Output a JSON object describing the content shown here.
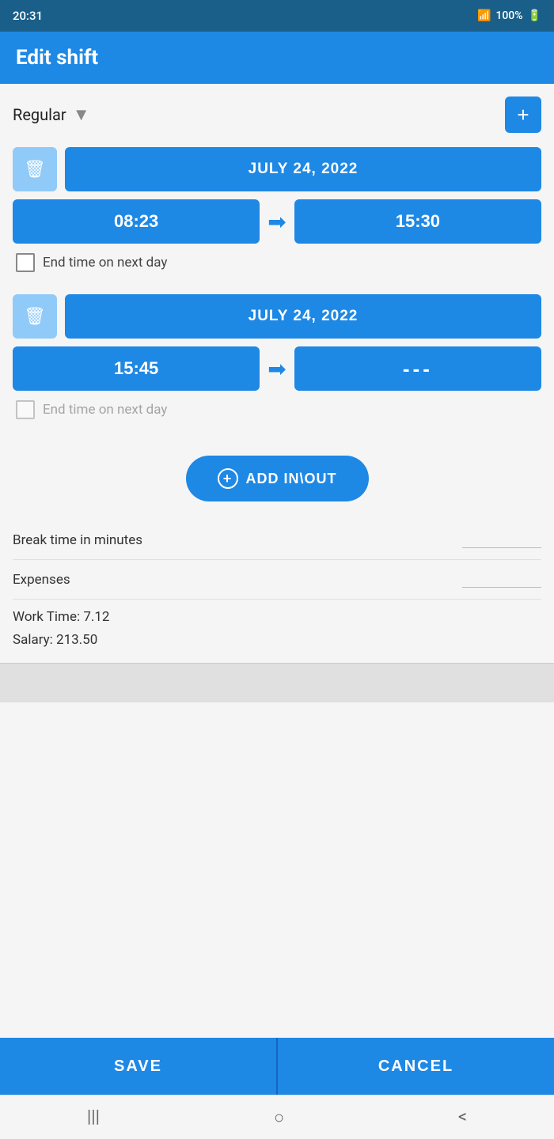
{
  "statusBar": {
    "time": "20:31",
    "battery": "100%",
    "signal": "WiFi+Cell"
  },
  "header": {
    "title": "Edit shift"
  },
  "shiftType": {
    "label": "Regular",
    "addButtonLabel": "+"
  },
  "shifts": [
    {
      "date": "JULY 24, 2022",
      "startTime": "08:23",
      "endTime": "15:30",
      "endNextDay": false,
      "endNextDayLabel": "End time on next day",
      "hasEndTime": true
    },
    {
      "date": "JULY 24, 2022",
      "startTime": "15:45",
      "endTime": "---",
      "endNextDay": false,
      "endNextDayLabel": "End time on next day",
      "hasEndTime": false
    }
  ],
  "addInOut": {
    "label": "ADD IN\\OUT"
  },
  "breakTime": {
    "label": "Break time in minutes",
    "value": ""
  },
  "expenses": {
    "label": "Expenses",
    "value": ""
  },
  "workTime": {
    "label": "Work Time:",
    "value": "7.12"
  },
  "salary": {
    "label": "Salary:",
    "value": "213.50"
  },
  "buttons": {
    "save": "SAVE",
    "cancel": "CANCEL"
  },
  "nav": {
    "menu": "|||",
    "home": "○",
    "back": "<"
  }
}
